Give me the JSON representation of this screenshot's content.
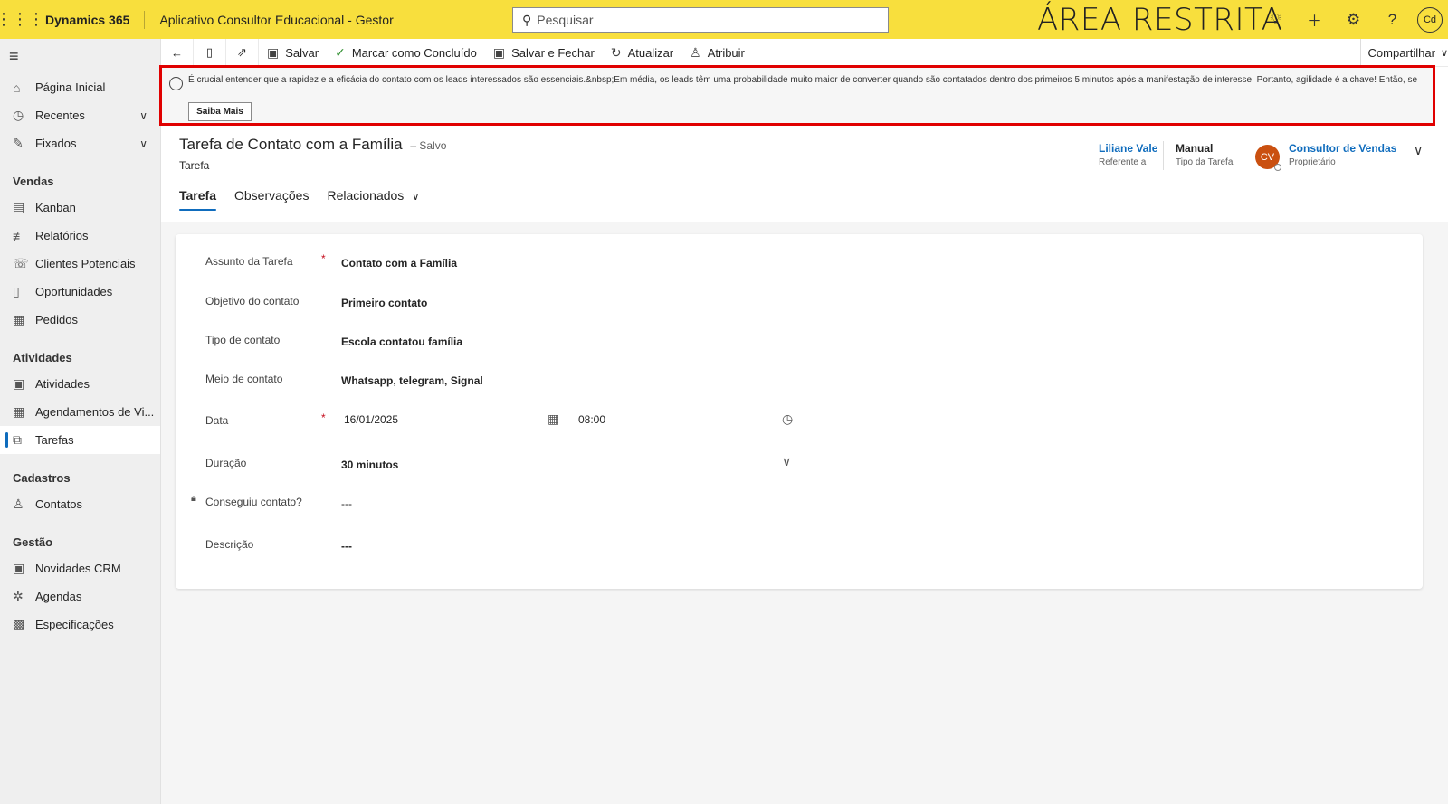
{
  "topbar": {
    "brand": "Dynamics 365",
    "app_name": "Aplicativo Consultor Educacional - Gestor",
    "search_placeholder": "Pesquisar",
    "restricted_label": "ÁREA RESTRITA",
    "user_initials": "Cd"
  },
  "sidebar": {
    "top_items": [
      {
        "label": "Página Inicial",
        "icon": "home-icon"
      },
      {
        "label": "Recentes",
        "icon": "clock-icon"
      },
      {
        "label": "Fixados",
        "icon": "pin-icon"
      }
    ],
    "groups": [
      {
        "title": "Vendas",
        "items": [
          {
            "label": "Kanban"
          },
          {
            "label": "Relatórios"
          },
          {
            "label": "Clientes Potenciais"
          },
          {
            "label": "Oportunidades"
          },
          {
            "label": "Pedidos"
          }
        ]
      },
      {
        "title": "Atividades",
        "items": [
          {
            "label": "Atividades"
          },
          {
            "label": "Agendamentos de Vi..."
          },
          {
            "label": "Tarefas",
            "active": true
          }
        ]
      },
      {
        "title": "Cadastros",
        "items": [
          {
            "label": "Contatos"
          }
        ]
      },
      {
        "title": "Gestão",
        "items": [
          {
            "label": "Novidades CRM"
          },
          {
            "label": "Agendas"
          },
          {
            "label": "Especificações"
          }
        ]
      }
    ]
  },
  "commandbar": {
    "save": "Salvar",
    "mark_complete": "Marcar como Concluído",
    "save_close": "Salvar e Fechar",
    "refresh": "Atualizar",
    "assign": "Atribuir",
    "share": "Compartilhar"
  },
  "notification": {
    "text": "É crucial entender que a rapidez e a eficácia do contato com os leads interessados são essenciais.&nbsp;Em média, os leads têm uma probabilidade muito maior de converter quando são contatados dentro dos primeiros 5 minutos após a manifestação de interesse. Portanto, agilidade é a chave! Então, se",
    "button": "Saiba Mais"
  },
  "record": {
    "title": "Tarefa de Contato com a Família",
    "saved_status": "– Salvo",
    "entity": "Tarefa",
    "header_fields": {
      "regarding_value": "Liliane Vale",
      "regarding_label": "Referente a",
      "task_type_value": "Manual",
      "task_type_label": "Tipo da Tarefa",
      "owner_initials": "CV",
      "owner_value": "Consultor de Vendas",
      "owner_label": "Proprietário"
    },
    "tabs": [
      "Tarefa",
      "Observações",
      "Relacionados"
    ]
  },
  "form": {
    "subject_label": "Assunto da Tarefa",
    "subject_value": "Contato com a Família",
    "objective_label": "Objetivo do contato",
    "objective_value": "Primeiro contato",
    "contact_type_label": "Tipo de contato",
    "contact_type_value": "Escola contatou família",
    "contact_medium_label": "Meio de contato",
    "contact_medium_value": "Whatsapp, telegram, Signal",
    "date_label": "Data",
    "date_value": "16/01/2025",
    "time_value": "08:00",
    "duration_label": "Duração",
    "duration_value": "30 minutos",
    "reached_label": "Conseguiu contato?",
    "reached_value": "---",
    "description_label": "Descrição",
    "description_value": "---",
    "required_mark": "*"
  },
  "colors": {
    "topbar_bg": "#f8df3d",
    "accent": "#0f6cbd",
    "notice_border": "#e00000",
    "owner_avatar": "#ca5010"
  }
}
